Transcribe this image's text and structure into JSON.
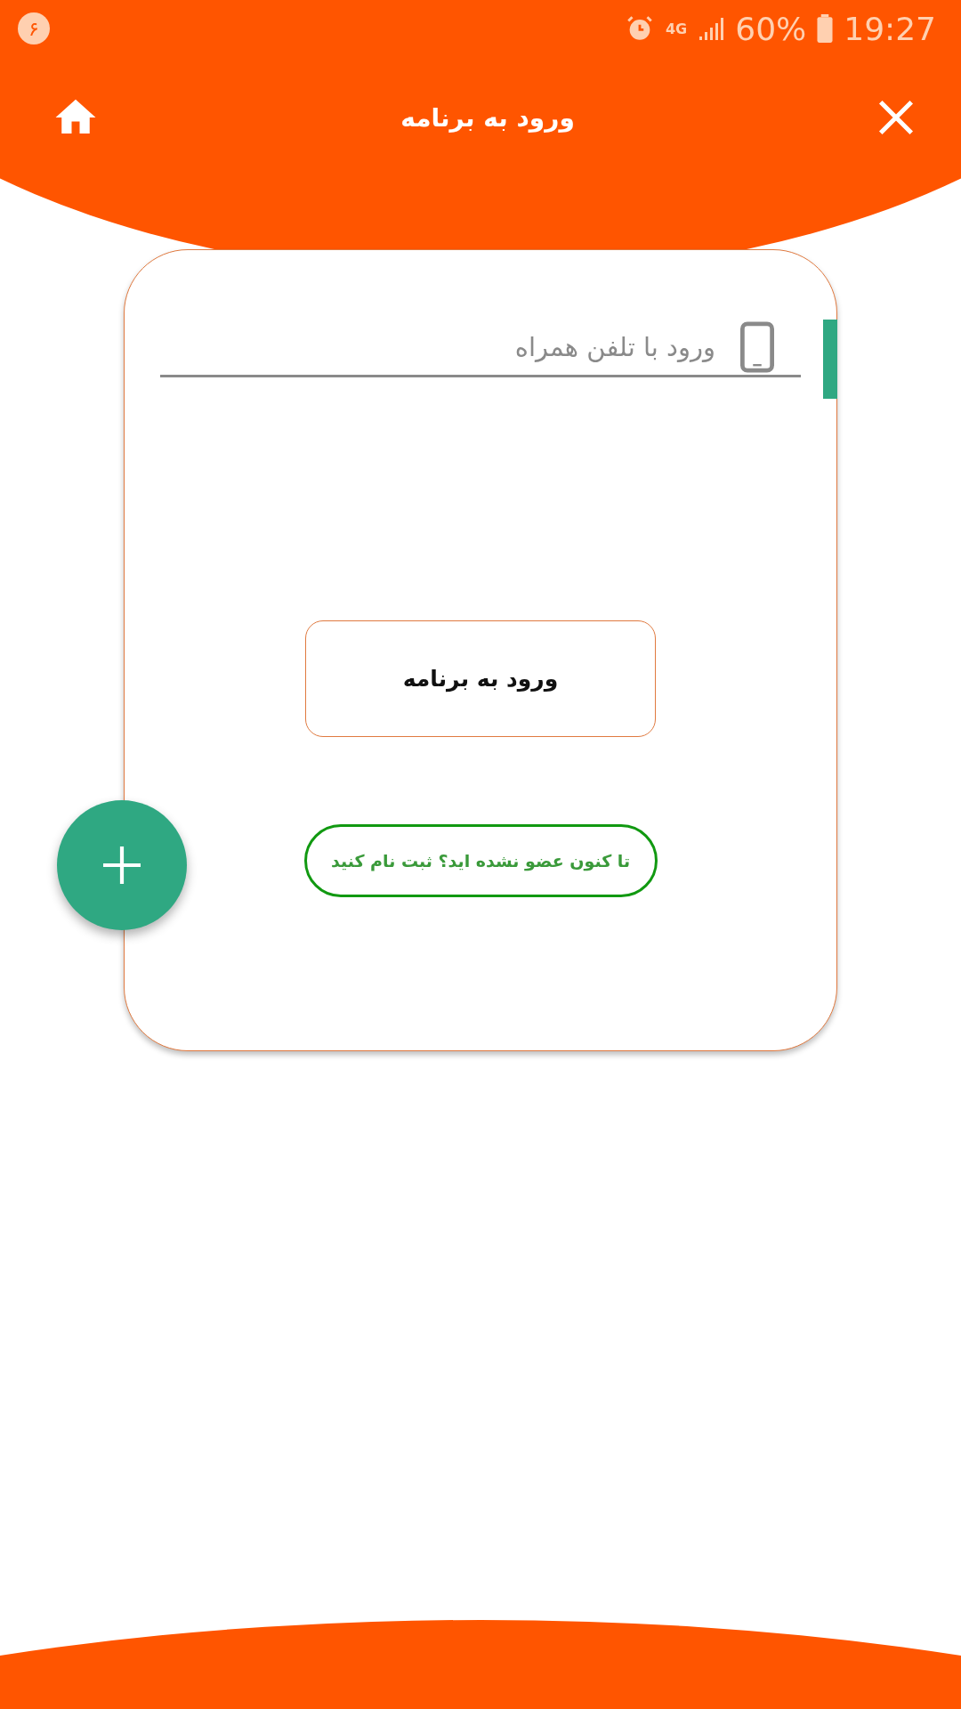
{
  "status_bar": {
    "notification": "۶",
    "network": "4G",
    "battery_percent": "60%",
    "time": "19:27"
  },
  "header": {
    "title": "ورود به برنامه"
  },
  "form": {
    "phone_field": {
      "placeholder": "ورود با تلفن همراه"
    },
    "login_button": "ورود به برنامه",
    "signup_button": "تا کنون عضو نشده اید؟ ثبت نام کنید"
  }
}
